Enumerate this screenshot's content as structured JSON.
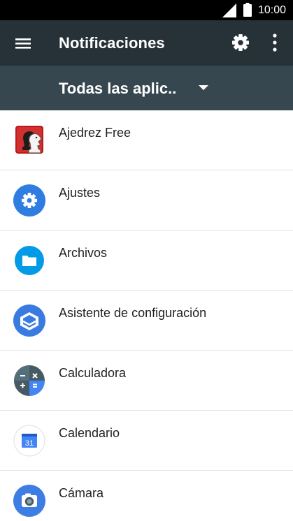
{
  "status_bar": {
    "time": "10:00",
    "icons": [
      "signal-icon",
      "battery-icon"
    ]
  },
  "app_bar": {
    "title": "Notificaciones",
    "icons": [
      "menu-icon",
      "settings-gear-icon",
      "more-vert-icon"
    ],
    "background": "#263238"
  },
  "filter": {
    "label": "Todas las aplic..",
    "icon": "dropdown-arrow-icon",
    "background": "#37474f"
  },
  "apps": [
    {
      "label": "Ajedrez Free",
      "icon": "chess-icon"
    },
    {
      "label": "Ajustes",
      "icon": "settings-app-icon"
    },
    {
      "label": "Archivos",
      "icon": "files-icon"
    },
    {
      "label": "Asistente de configuración",
      "icon": "setup-wizard-icon"
    },
    {
      "label": "Calculadora",
      "icon": "calculator-icon"
    },
    {
      "label": "Calendario",
      "icon": "calendar-icon",
      "day": "31"
    },
    {
      "label": "Cámara",
      "icon": "camera-icon"
    }
  ],
  "colors": {
    "accent_blue": "#2f7de1",
    "list_text": "#212121",
    "divider": "#e3e3e3"
  }
}
